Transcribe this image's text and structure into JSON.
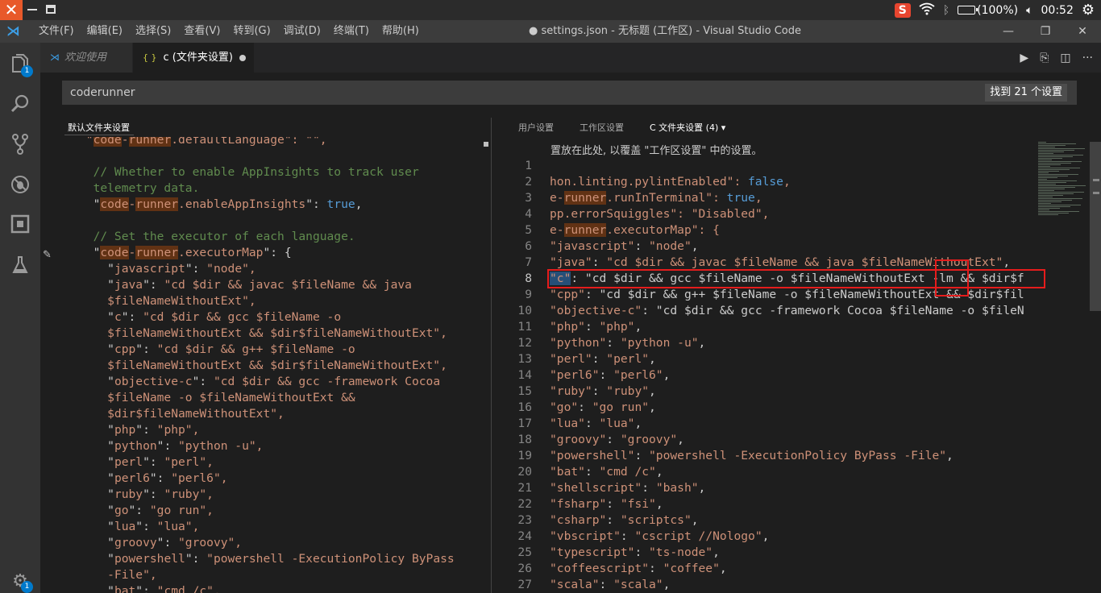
{
  "system_tray": {
    "sogou_label": "S",
    "battery_text": "(100%)",
    "clock": "00:52"
  },
  "menu": [
    "文件(F)",
    "编辑(E)",
    "选择(S)",
    "查看(V)",
    "转到(G)",
    "调试(D)",
    "终端(T)",
    "帮助(H)"
  ],
  "window_title": "● settings.json - 无标题 (工作区) - Visual Studio Code",
  "activity": {
    "explorer_badge": "1",
    "settings_badge": "1"
  },
  "tabs": [
    {
      "label": "欢迎使用"
    },
    {
      "label": "c (文件夹设置)"
    }
  ],
  "search": {
    "value": "coderunner",
    "result_text": "找到 21 个设置"
  },
  "left_pane": {
    "header": "默认文件夹设置"
  },
  "right_pane": {
    "tabs": [
      "用户设置",
      "工作区设置",
      "C  文件夹设置 (4) ▾"
    ],
    "description": "置放在此处, 以覆盖 \"工作区设置\" 中的设置。"
  },
  "left_code": [
    [
      [
        "",
        "key",
        " \"code-runner.defaultLanguage\": \"\","
      ]
    ],
    [
      [
        "",
        "key",
        ""
      ]
    ],
    [
      [
        "",
        "com",
        "  // Whether to enable AppInsights to track user"
      ]
    ],
    [
      [
        "",
        "com",
        "  telemetry data."
      ]
    ],
    [
      [
        "k",
        "code-runner.enableAppInsights",
        "true"
      ]
    ],
    [
      [
        "",
        "key",
        ""
      ]
    ],
    [
      [
        "",
        "com",
        "  // Set the executor of each language."
      ]
    ],
    [
      [
        "e",
        "code-runner.executorMap",
        "{"
      ]
    ],
    [
      [
        "s",
        "javascript",
        "node"
      ]
    ],
    [
      [
        "s",
        "java",
        "cd $dir && javac $fileName && java"
      ]
    ],
    [
      [
        "",
        "str",
        "    $fileNameWithoutExt\","
      ]
    ],
    [
      [
        "s",
        "c",
        "cd $dir && gcc $fileName -o"
      ]
    ],
    [
      [
        "",
        "str",
        "    $fileNameWithoutExt && $dir$fileNameWithoutExt\","
      ]
    ],
    [
      [
        "s",
        "cpp",
        "cd $dir && g++ $fileName -o"
      ]
    ],
    [
      [
        "",
        "str",
        "    $fileNameWithoutExt && $dir$fileNameWithoutExt\","
      ]
    ],
    [
      [
        "s",
        "objective-c",
        "cd $dir && gcc -framework Cocoa"
      ]
    ],
    [
      [
        "",
        "str",
        "    $fileName -o $fileNameWithoutExt &&"
      ]
    ],
    [
      [
        "",
        "str",
        "    $dir$fileNameWithoutExt\","
      ]
    ],
    [
      [
        "s",
        "php",
        "php"
      ]
    ],
    [
      [
        "s",
        "python",
        "python -u"
      ]
    ],
    [
      [
        "s",
        "perl",
        "perl"
      ]
    ],
    [
      [
        "s",
        "perl6",
        "perl6"
      ]
    ],
    [
      [
        "s",
        "ruby",
        "ruby"
      ]
    ],
    [
      [
        "s",
        "go",
        "go run"
      ]
    ],
    [
      [
        "s",
        "lua",
        "lua"
      ]
    ],
    [
      [
        "s",
        "groovy",
        "groovy"
      ]
    ],
    [
      [
        "s",
        "powershell",
        "powershell -ExecutionPolicy ByPass"
      ]
    ],
    [
      [
        "",
        "str",
        "    -File\","
      ]
    ],
    [
      [
        "s",
        "bat",
        "cmd /c"
      ]
    ]
  ],
  "right_code": {
    "line_numbers": [
      "1",
      "2",
      "3",
      "4",
      "5",
      "6",
      "7",
      "8",
      "9",
      "10",
      "11",
      "12",
      "13",
      "14",
      "15",
      "16",
      "17",
      "18",
      "19",
      "20",
      "21",
      "22",
      "23",
      "24",
      "25",
      "26",
      "27"
    ],
    "lines": [
      "",
      "hon.linting.pylintEnabled\": false,",
      "e-runner.runInTerminal\": true,",
      "pp.errorSquiggles\": \"Disabled\",",
      "e-runner.executorMap\": {",
      "\"javascript\": \"node\",",
      "\"java\": \"cd $dir && javac $fileName && java $fileNameWithoutExt\",",
      "\"c\": \"cd $dir && gcc $fileName -o $fileNameWithoutExt -lm && $dir$f",
      "\"cpp\": \"cd $dir && g++ $fileName -o $fileNameWithoutExt && $dir$fil",
      "\"objective-c\": \"cd $dir && gcc -framework Cocoa $fileName -o $fileN",
      "\"php\": \"php\",",
      "\"python\": \"python -u\",",
      "\"perl\": \"perl\",",
      "\"perl6\": \"perl6\",",
      "\"ruby\": \"ruby\",",
      "\"go\": \"go run\",",
      "\"lua\": \"lua\",",
      "\"groovy\": \"groovy\",",
      "\"powershell\": \"powershell -ExecutionPolicy ByPass -File\",",
      "\"bat\": \"cmd /c\",",
      "\"shellscript\": \"bash\",",
      "\"fsharp\": \"fsi\",",
      "\"csharp\": \"scriptcs\",",
      "\"vbscript\": \"cscript //Nologo\",",
      "\"typescript\": \"ts-node\",",
      "\"coffeescript\": \"coffee\",",
      "\"scala\": \"scala\","
    ]
  },
  "colors": {
    "accent": "#007acc",
    "highlight_box": "#e51c1c",
    "string": "#ce9178",
    "comment": "#608b4e",
    "keyword": "#569cd6"
  }
}
